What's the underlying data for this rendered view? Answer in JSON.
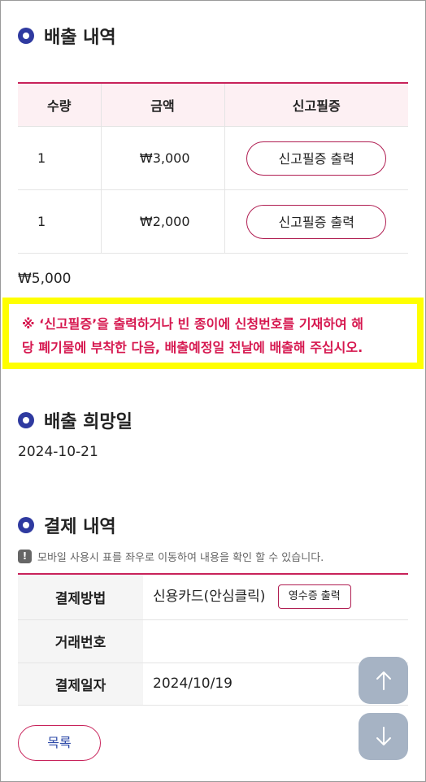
{
  "disposal": {
    "title": "배출 내역",
    "columns": [
      "수량",
      "금액",
      "신고필증"
    ],
    "rows": [
      {
        "qty": "1",
        "amount": "₩3,000",
        "button": "신고필증 출력"
      },
      {
        "qty": "1",
        "amount": "₩2,000",
        "button": "신고필증 출력"
      }
    ],
    "total": "₩5,000",
    "notice_line1": "※ ‘신고필증’을 출력하거나 빈 종이에 신청번호를 기재하여 해",
    "notice_line2": "당 폐기물에 부착한 다음, 배출예정일 전날에 배출해 주십시오."
  },
  "desired_date": {
    "title": "배출 희망일",
    "value": "2024-10-21"
  },
  "payment": {
    "title": "결제 내역",
    "mobile_note": "모바일 사용시 표를 좌우로 이동하여 내용을 확인 할 수 있습니다.",
    "method_label": "결제방법",
    "method_value": "신용카드(안심클릭)",
    "receipt_button": "영수증 출력",
    "txn_label": "거래번호",
    "txn_value": "",
    "date_label": "결제일자",
    "date_value": "2024/10/19"
  },
  "buttons": {
    "list": "목록"
  },
  "colors": {
    "accent": "#c8225a",
    "notice_text": "#d6174f",
    "highlight": "#ffff00",
    "bullet": "#2f3aa0",
    "float_button": "#a6b3c4"
  }
}
